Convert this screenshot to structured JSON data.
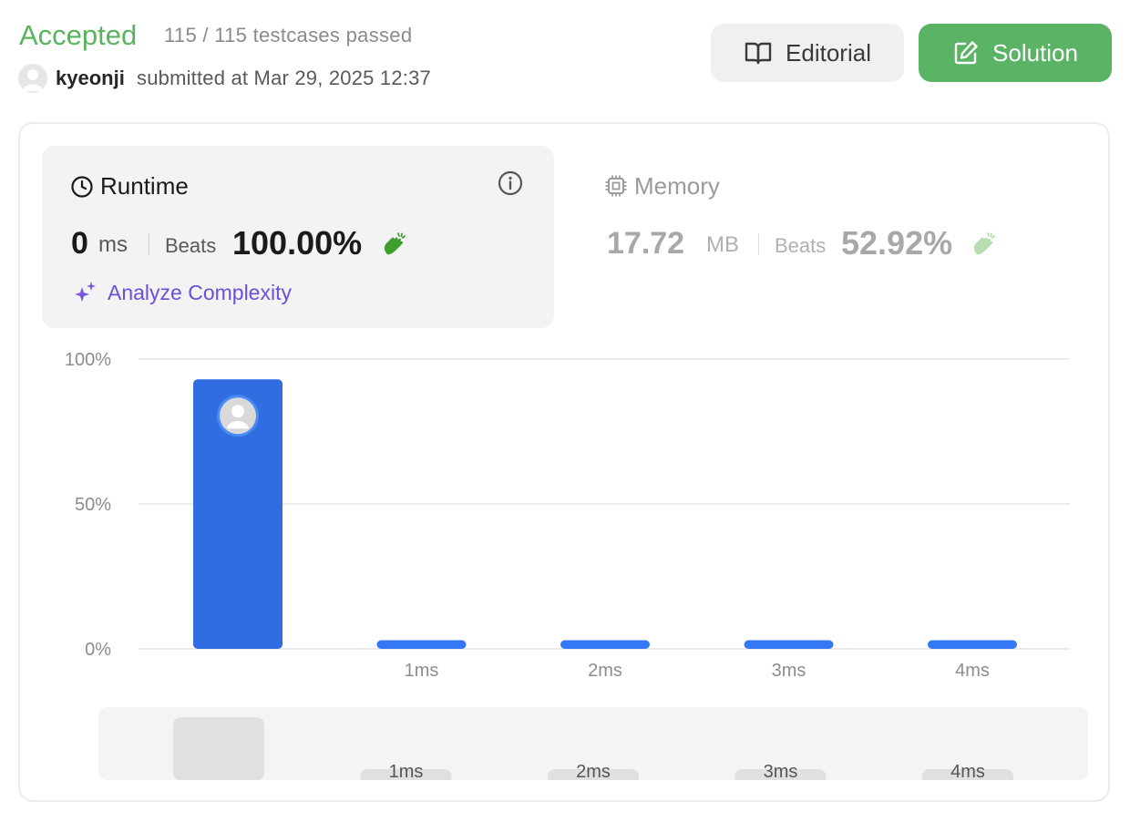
{
  "header": {
    "status": "Accepted",
    "testcases": "115 / 115 testcases passed",
    "username": "kyeonji",
    "submitted": "submitted at Mar 29, 2025 12:37",
    "editorial_label": "Editorial",
    "solution_label": "Solution"
  },
  "runtime": {
    "title": "Runtime",
    "value": "0",
    "unit": "ms",
    "beats_label": "Beats",
    "beats": "100.00%",
    "analyze_label": "Analyze Complexity"
  },
  "memory": {
    "title": "Memory",
    "value": "17.72",
    "unit": "MB",
    "beats_label": "Beats",
    "beats": "52.92%"
  },
  "colors": {
    "accepted": "#58b55e",
    "bar": "#3478f6",
    "bar_selected": "#2f6de1",
    "navigator_bar": "#e0e0e0"
  },
  "chart_data": {
    "type": "bar",
    "categories": [
      "",
      "1ms",
      "2ms",
      "3ms",
      "4ms"
    ],
    "values": [
      93,
      3,
      3,
      3,
      3
    ],
    "ylim": [
      0,
      100
    ],
    "yticks": [
      "100%",
      "50%",
      "0%"
    ],
    "ytick_values": [
      100,
      50,
      0
    ],
    "grid": true,
    "selected_index": 0,
    "navigator": {
      "categories": [
        "",
        "1ms",
        "2ms",
        "3ms",
        "4ms"
      ],
      "values": [
        93,
        3,
        3,
        3,
        3
      ]
    }
  }
}
